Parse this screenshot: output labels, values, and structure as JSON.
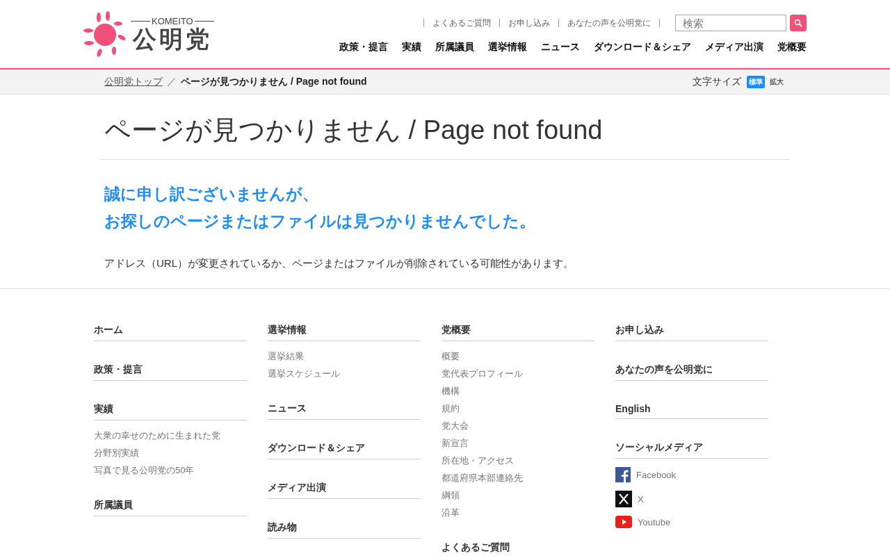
{
  "header": {
    "logo": {
      "sub": "KOMEITO",
      "name": "公明党"
    },
    "utility_links": [
      "よくあるご質問",
      "お申し込み",
      "あなたの声を公明党に"
    ],
    "search": {
      "placeholder": "検索"
    },
    "nav": [
      "政策・提言",
      "実績",
      "所属議員",
      "選挙情報",
      "ニュース",
      "ダウンロード＆シェア",
      "メディア出演",
      "党概要"
    ]
  },
  "breadcrumb": {
    "items": [
      {
        "label": "公明党トップ",
        "kind": "link"
      },
      {
        "label": "ページが見つかりません / Page not found",
        "kind": "current"
      }
    ],
    "separator": "／",
    "font_size": {
      "label": "文字サイズ",
      "options": [
        {
          "label": "標準",
          "selected": true
        },
        {
          "label": "拡大",
          "selected": false
        }
      ]
    }
  },
  "page_title": "ページが見つかりません / Page not found",
  "apology": [
    "誠に申し訳ございませんが、",
    "お探しのページまたはファイルは見つかりませんでした。"
  ],
  "message": "アドレス（URL）が変更されているか、ページまたはファイルが削除されている可能性があります。",
  "footer": {
    "columns": [
      [
        {
          "title": "ホーム"
        },
        {
          "title": "政策・提言"
        },
        {
          "title": "実績",
          "links": [
            "大衆の幸せのために生まれた党",
            "分野別実績",
            "写真で見る公明党の50年"
          ]
        },
        {
          "title": "所属議員"
        }
      ],
      [
        {
          "title": "選挙情報",
          "links": [
            "選挙結果",
            "選挙スケジュール"
          ]
        },
        {
          "title": "ニュース"
        },
        {
          "title": "ダウンロード＆シェア"
        },
        {
          "title": "メディア出演"
        },
        {
          "title": "読み物"
        }
      ],
      [
        {
          "title": "党概要",
          "links": [
            "概要",
            "党代表プロフィール",
            "機構",
            "規約",
            "党大会",
            "新宣言",
            "所在地・アクセス",
            "都道府県本部連絡先",
            "綱領",
            "沿革"
          ]
        },
        {
          "title": "よくあるご質問"
        }
      ],
      [
        {
          "title": "お申し込み"
        },
        {
          "title": "あなたの声を公明党に"
        },
        {
          "title": "English"
        },
        {
          "title": "ソーシャルメディア",
          "social": [
            {
              "kind": "facebook",
              "label": "Facebook"
            },
            {
              "kind": "x",
              "label": "X"
            },
            {
              "kind": "youtube",
              "label": "Youtube"
            }
          ]
        }
      ]
    ]
  }
}
